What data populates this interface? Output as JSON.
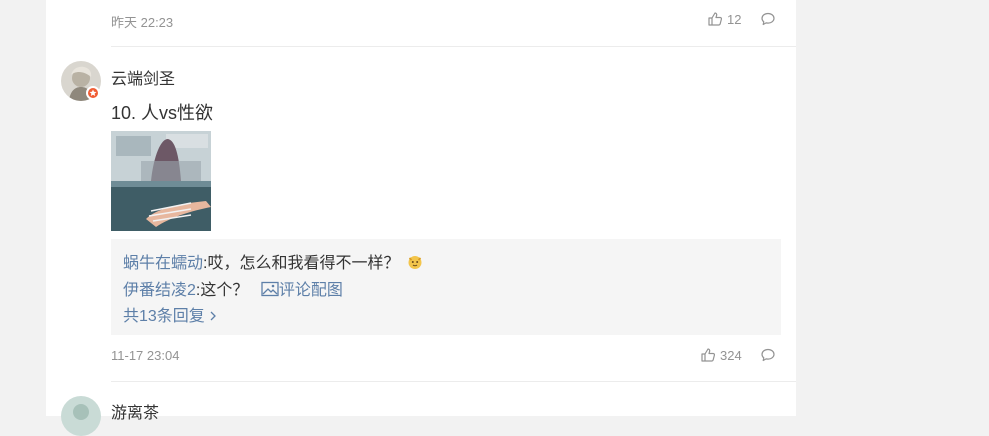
{
  "prev_comment": {
    "time": "昨天 22:23",
    "likes": "12"
  },
  "comment": {
    "username": "云端剑圣",
    "text": "10. 人vs性欲",
    "time": "11-17 23:04",
    "likes": "324",
    "replies": [
      {
        "name": "蜗牛在蠕动",
        "sep": ":",
        "text": "哎，怎么和我看得不一样？"
      },
      {
        "name": "伊番结凌2",
        "sep": ":",
        "text": "这个？",
        "link": "评论配图"
      }
    ],
    "more_replies": "共13条回复"
  },
  "next_comment": {
    "username": "游离茶"
  },
  "icons": [
    "like-icon",
    "comment-icon",
    "emoji-icon",
    "image-icon",
    "chevron-right-icon",
    "verified-badge-icon"
  ],
  "colors": {
    "link": "#5d7fa8",
    "meta": "#939393",
    "badge": "#f05c33",
    "reply_bg": "#f5f5f5"
  }
}
